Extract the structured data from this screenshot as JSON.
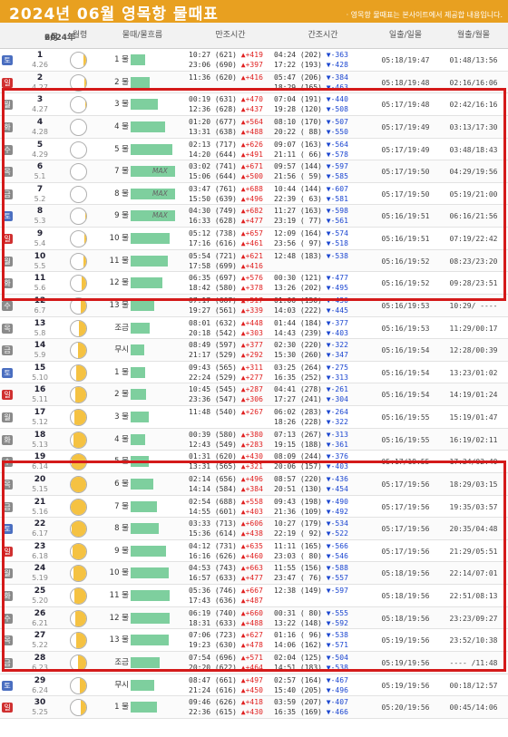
{
  "header": {
    "title": "2024년  06월  영목항  물때표",
    "note": "· 영목항 물때표는 본사이트에서 제공합 내용입니다."
  },
  "columns": {
    "date_day": "2024年",
    "date_month": "6月",
    "moon": "월령",
    "mul": "물때/물흐름",
    "high": "만조시간",
    "low": "간조시간",
    "sun": "일출/일몰",
    "moonrise": "월출/월몰"
  },
  "colors": {
    "header": "#e8a020",
    "highlight": "#d41a1a",
    "flow_bar": "#7ecf9e",
    "moon": "#f5c242",
    "up": "#e02020",
    "down": "#1a45d0"
  },
  "rows": [
    {
      "wd": "토",
      "type": "sat",
      "day": "1",
      "lunar": "4.26",
      "phase": 0.18,
      "mul": "1 물",
      "flow": 0.3,
      "max": "",
      "hi": [
        "10:27 (621) ▲+419",
        "23:06 (690) ▲+397"
      ],
      "lo": [
        "04:24 (202) ▼-363",
        "17:22 (193) ▼-428"
      ],
      "sun": "05:18/19:47",
      "moonrise": "01:48/13:56"
    },
    {
      "wd": "일",
      "type": "sun",
      "day": "2",
      "lunar": "4.27",
      "phase": 0.12,
      "mul": "2 물",
      "flow": 0.4,
      "max": "",
      "hi": [
        "11:36 (620) ▲+416",
        ""
      ],
      "lo": [
        "05:47 (206) ▼-384",
        "18:29 (165) ▼-463"
      ],
      "sun": "05:18/19:48",
      "moonrise": "02:16/16:06"
    },
    {
      "wd": "월",
      "type": "",
      "day": "3",
      "lunar": "4.27",
      "phase": 0.07,
      "mul": "3 물",
      "flow": 0.58,
      "max": "",
      "hi": [
        "00:19 (631) ▲+470",
        "12:36 (628) ▲+437"
      ],
      "lo": [
        "07:04 (191) ▼-440",
        "19:28 (120) ▼-508"
      ],
      "sun": "05:17/19:48",
      "moonrise": "02:42/16:16"
    },
    {
      "wd": "화",
      "type": "",
      "day": "4",
      "lunar": "4.28",
      "phase": 0.03,
      "mul": "4 물",
      "flow": 0.73,
      "max": "",
      "hi": [
        "01:20 (677) ▲+564",
        "13:31 (638) ▲+488"
      ],
      "lo": [
        "08:10 (170) ▼-507",
        "20:22 ( 88) ▼-550"
      ],
      "sun": "05:17/19:49",
      "moonrise": "03:13/17:30"
    },
    {
      "wd": "수",
      "type": "",
      "day": "5",
      "lunar": "4.29",
      "phase": 0.0,
      "mul": "5 물",
      "flow": 0.88,
      "max": "",
      "hi": [
        "02:13 (717) ▲+626",
        "14:20 (644) ▲+491"
      ],
      "lo": [
        "09:07 (163) ▼-564",
        "21:11 ( 66) ▼-578"
      ],
      "sun": "05:17/19:49",
      "moonrise": "03:48/18:43"
    },
    {
      "wd": "목",
      "type": "",
      "day": "6",
      "lunar": "5.1",
      "phase": 0.0,
      "mul": "7 물",
      "flow": 0.95,
      "max": "MAX",
      "hi": [
        "03:02 (741) ▲+671",
        "15:06 (644) ▲+500"
      ],
      "lo": [
        "09:57 (144) ▼-597",
        "21:56 ( 59) ▼-585"
      ],
      "sun": "05:17/19:50",
      "moonrise": "04:29/19:56"
    },
    {
      "wd": "금",
      "type": "",
      "day": "7",
      "lunar": "5.2",
      "phase": 0.03,
      "mul": "8 물",
      "flow": 0.95,
      "max": "MAX",
      "hi": [
        "03:47 (761) ▲+688",
        "15:50 (639) ▲+496"
      ],
      "lo": [
        "10:44 (144) ▼-607",
        "22:39 ( 63) ▼-581"
      ],
      "sun": "05:17/19:50",
      "moonrise": "05:19/21:00"
    },
    {
      "wd": "토",
      "type": "sat",
      "day": "8",
      "lunar": "5.3",
      "phase": 0.07,
      "mul": "9 물",
      "flow": 0.95,
      "max": "MAX",
      "hi": [
        "04:30 (749) ▲+682",
        "16:33 (628) ▲+477"
      ],
      "lo": [
        "11:27 (163) ▼-598",
        "23:19 ( 77) ▼-561"
      ],
      "sun": "05:16/19:51",
      "moonrise": "06:16/21:56"
    },
    {
      "wd": "일",
      "type": "sun",
      "day": "9",
      "lunar": "5.4",
      "phase": 0.12,
      "mul": "10 물",
      "flow": 0.82,
      "max": "",
      "hi": [
        "05:12 (738) ▲+657",
        "17:16 (616) ▲+461"
      ],
      "lo": [
        "12:09 (164) ▼-574",
        "23:56 ( 97) ▼-518"
      ],
      "sun": "05:16/19:51",
      "moonrise": "07:19/22:42"
    },
    {
      "wd": "월",
      "type": "",
      "day": "10",
      "lunar": "5.5",
      "phase": 0.2,
      "mul": "11 물",
      "flow": 0.79,
      "max": "",
      "hi": [
        "05:54 (721) ▲+621",
        "17:58 (699) ▲+416"
      ],
      "lo": [
        "12:48 (183) ▼-538",
        ""
      ],
      "sun": "05:16/19:52",
      "moonrise": "08:23/23:20"
    },
    {
      "wd": "화",
      "type": "",
      "day": "11",
      "lunar": "5.6",
      "phase": 0.28,
      "mul": "12 물",
      "flow": 0.67,
      "max": "",
      "hi": [
        "06:35 (697) ▲+576",
        "18:42 (580) ▲+378"
      ],
      "lo": [
        "00:30 (121) ▼-477",
        "13:26 (202) ▼-495"
      ],
      "sun": "05:16/19:52",
      "moonrise": "09:28/23:51"
    },
    {
      "wd": "수",
      "type": "",
      "day": "12",
      "lunar": "6.7",
      "phase": 0.38,
      "mul": "13 물",
      "flow": 0.5,
      "max": "",
      "hi": [
        "07:17 (667) ▲+517",
        "19:27 (561) ▲+339"
      ],
      "lo": [
        "01:06 (150) ▼-430",
        "14:03 (222) ▼-445"
      ],
      "sun": "05:16/19:53",
      "moonrise": "10:29/ ----"
    },
    {
      "wd": "목",
      "type": "",
      "day": "13",
      "lunar": "5.8",
      "phase": 0.48,
      "mul": "조금",
      "flow": 0.4,
      "max": "",
      "hi": [
        "08:01 (632) ▲+448",
        "20:18 (542) ▲+303"
      ],
      "lo": [
        "01:44 (184) ▼-377",
        "14:43 (239) ▼-403"
      ],
      "sun": "05:16/19:53",
      "moonrise": "11:29/00:17"
    },
    {
      "wd": "금",
      "type": "",
      "day": "14",
      "lunar": "5.9",
      "phase": 0.55,
      "mul": "무시",
      "flow": 0.28,
      "max": "",
      "hi": [
        "08:49 (597) ▲+377",
        "21:17 (529) ▲+292"
      ],
      "lo": [
        "02:30 (220) ▼-322",
        "15:30 (260) ▼-347"
      ],
      "sun": "05:16/19:54",
      "moonrise": "12:28/00:39"
    },
    {
      "wd": "토",
      "type": "sat",
      "day": "15",
      "lunar": "5.10",
      "phase": 0.62,
      "mul": "1 물",
      "flow": 0.3,
      "max": "",
      "hi": [
        "09:43 (565) ▲+311",
        "22:24 (529) ▲+277"
      ],
      "lo": [
        "03:25 (264) ▼-275",
        "16:35 (252) ▼-313"
      ],
      "sun": "05:16/19:54",
      "moonrise": "13:23/01:02"
    },
    {
      "wd": "일",
      "type": "sun",
      "day": "16",
      "lunar": "5.11",
      "phase": 0.7,
      "mul": "2 물",
      "flow": 0.33,
      "max": "",
      "hi": [
        "10:45 (545) ▲+287",
        "23:36 (547) ▲+306"
      ],
      "lo": [
        "04:41 (278) ▼-261",
        "17:27 (241) ▼-304"
      ],
      "sun": "05:16/19:54",
      "moonrise": "14:19/01:24"
    },
    {
      "wd": "월",
      "type": "",
      "day": "17",
      "lunar": "5.12",
      "phase": 0.78,
      "mul": "3 물",
      "flow": 0.38,
      "max": "",
      "hi": [
        "11:48 (540) ▲+267",
        ""
      ],
      "lo": [
        "06:02 (283) ▼-264",
        "18:26 (228) ▼-322"
      ],
      "sun": "05:16/19:55",
      "moonrise": "15:19/01:47"
    },
    {
      "wd": "화",
      "type": "",
      "day": "18",
      "lunar": "5.13",
      "phase": 0.85,
      "mul": "4 물",
      "flow": 0.3,
      "max": "",
      "hi": [
        "00:39 (580) ▲+380",
        "12:43 (549) ▲+283"
      ],
      "lo": [
        "07:13 (267) ▼-313",
        "19:15 (188) ▼-361"
      ],
      "sun": "05:16/19:55",
      "moonrise": "16:19/02:11"
    },
    {
      "wd": "수",
      "type": "",
      "day": "19",
      "lunar": "6.14",
      "phase": 0.92,
      "mul": "5 물",
      "flow": 0.38,
      "max": "",
      "hi": [
        "01:31 (620) ▲+430",
        "13:31 (565) ▲+321"
      ],
      "lo": [
        "08:09 (244) ▼-376",
        "20:06 (157) ▼-403"
      ],
      "sun": "05:17/19:55",
      "moonrise": "17:24/02:40"
    },
    {
      "wd": "목",
      "type": "",
      "day": "20",
      "lunar": "5.15",
      "phase": 1.0,
      "mul": "6 물",
      "flow": 0.48,
      "max": "",
      "hi": [
        "02:14 (656) ▲+496",
        "14:14 (584) ▲+384"
      ],
      "lo": [
        "08:57 (220) ▼-436",
        "20:51 (130) ▼-454"
      ],
      "sun": "05:17/19:56",
      "moonrise": "18:29/03:15"
    },
    {
      "wd": "금",
      "type": "",
      "day": "21",
      "lunar": "5.16",
      "phase": 1.0,
      "mul": "7 물",
      "flow": 0.55,
      "max": "",
      "hi": [
        "02:54 (688) ▲+558",
        "14:55 (601) ▲+403"
      ],
      "lo": [
        "09:43 (198) ▼-490",
        "21:36 (109) ▼-492"
      ],
      "sun": "05:17/19:56",
      "moonrise": "19:35/03:57"
    },
    {
      "wd": "토",
      "type": "sat",
      "day": "22",
      "lunar": "6.17",
      "phase": 0.95,
      "mul": "8 물",
      "flow": 0.6,
      "max": "",
      "hi": [
        "03:33 (713) ▲+606",
        "15:36 (614) ▲+438"
      ],
      "lo": [
        "10:27 (179) ▼-534",
        "22:19 ( 92) ▼-522"
      ],
      "sun": "05:17/19:56",
      "moonrise": "20:35/04:48"
    },
    {
      "wd": "일",
      "type": "sun",
      "day": "23",
      "lunar": "6.18",
      "phase": 0.9,
      "mul": "9 물",
      "flow": 0.75,
      "max": "",
      "hi": [
        "04:12 (731) ▲+635",
        "16:16 (626) ▲+460"
      ],
      "lo": [
        "11:11 (165) ▼-566",
        "23:03 ( 80) ▼-546"
      ],
      "sun": "05:17/19:56",
      "moonrise": "21:29/05:51"
    },
    {
      "wd": "월",
      "type": "",
      "day": "24",
      "lunar": "5.19",
      "phase": 0.84,
      "mul": "10 물",
      "flow": 0.8,
      "max": "",
      "hi": [
        "04:53 (743) ▲+663",
        "16:57 (633) ▲+477"
      ],
      "lo": [
        "11:55 (156) ▼-588",
        "23:47 ( 76) ▼-557"
      ],
      "sun": "05:18/19:56",
      "moonrise": "22:14/07:01"
    },
    {
      "wd": "화",
      "type": "",
      "day": "25",
      "lunar": "5.20",
      "phase": 0.78,
      "mul": "11 물",
      "flow": 0.82,
      "max": "",
      "hi": [
        "05:36 (746) ▲+667",
        "17:43 (636) ▲+487"
      ],
      "lo": [
        "12:38 (149) ▼-597",
        ""
      ],
      "sun": "05:18/19:56",
      "moonrise": "22:51/08:13"
    },
    {
      "wd": "수",
      "type": "",
      "day": "26",
      "lunar": "6.21",
      "phase": 0.7,
      "mul": "12 물",
      "flow": 0.82,
      "max": "",
      "hi": [
        "06:19 (740) ▲+660",
        "18:31 (633) ▲+488"
      ],
      "lo": [
        "00:31 ( 80) ▼-555",
        "13:22 (148) ▼-592"
      ],
      "sun": "05:18/19:56",
      "moonrise": "23:23/09:27"
    },
    {
      "wd": "목",
      "type": "",
      "day": "27",
      "lunar": "5.22",
      "phase": 0.62,
      "mul": "13 물",
      "flow": 0.8,
      "max": "",
      "hi": [
        "07:06 (723) ▲+627",
        "19:23 (630) ▲+478"
      ],
      "lo": [
        "01:16 ( 96) ▼-538",
        "14:06 (162) ▼-571"
      ],
      "sun": "05:19/19:56",
      "moonrise": "23:52/10:38"
    },
    {
      "wd": "금",
      "type": "",
      "day": "28",
      "lunar": "6.23",
      "phase": 0.52,
      "mul": "조금",
      "flow": 0.62,
      "max": "",
      "hi": [
        "07:54 (696) ▲+571",
        "20:20 (622) ▲+464"
      ],
      "lo": [
        "02:04 (125) ▼-504",
        "14:51 (183) ▼-538"
      ],
      "sun": "05:19/19:56",
      "moonrise": "---- /11:48"
    },
    {
      "wd": "토",
      "type": "sat",
      "day": "29",
      "lunar": "6.24",
      "phase": 0.44,
      "mul": "무시",
      "flow": 0.5,
      "max": "",
      "hi": [
        "08:47 (661) ▲+497",
        "21:24 (616) ▲+450"
      ],
      "lo": [
        "02:57 (164) ▼-467",
        "15:40 (205) ▼-496"
      ],
      "sun": "05:19/19:56",
      "moonrise": "00:18/12:57"
    },
    {
      "wd": "일",
      "type": "sun",
      "day": "30",
      "lunar": "5.25",
      "phase": 0.36,
      "mul": "1 물",
      "flow": 0.55,
      "max": "",
      "hi": [
        "09:46 (626) ▲+418",
        "22:36 (615) ▲+430"
      ],
      "lo": [
        "03:59 (207) ▼-407",
        "16:35 (169) ▼-466"
      ],
      "sun": "05:20/19:56",
      "moonrise": "00:45/14:06"
    }
  ]
}
